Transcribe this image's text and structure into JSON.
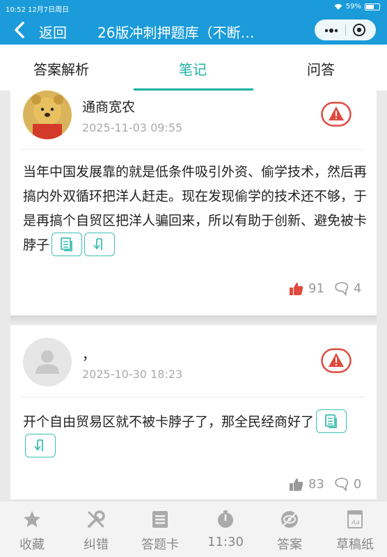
{
  "status_bar": {
    "time_date": "10:52  12月7日周日",
    "battery": "59%"
  },
  "nav": {
    "back_label": "返回",
    "title": "26版冲刺押题库（不断…"
  },
  "tabs": [
    {
      "label": "答案解析"
    },
    {
      "label": "笔记",
      "active": true
    },
    {
      "label": "问答"
    }
  ],
  "notes": [
    {
      "author": "通商宽农",
      "date": "2025-11-03 09:55",
      "content": "当年中国发展靠的就是低条件吸引外资、偷学技术，然后再搞内外双循环把洋人赶走。现在发现偷学的技术还不够，于是再搞个自贸区把洋人骗回来，所以有助于创新、避免被卡脖子",
      "likes": "91",
      "comments": "4",
      "liked": true
    },
    {
      "author": "，",
      "date": "2025-10-30 18:23",
      "content": "开个自由贸易区就不被卡脖子了，那全民经商好了",
      "likes": "83",
      "comments": "0",
      "liked": false
    }
  ],
  "toolbar": [
    {
      "label": "收藏",
      "icon": "star-icon"
    },
    {
      "label": "纠错",
      "icon": "wrench-icon"
    },
    {
      "label": "答题卡",
      "icon": "card-icon"
    },
    {
      "label": "11:30",
      "icon": "timer-icon"
    },
    {
      "label": "答案",
      "icon": "eye-off-icon"
    },
    {
      "label": "草稿纸",
      "icon": "draft-icon"
    }
  ],
  "colors": {
    "nav_bg": "#1b9bd9",
    "accent": "#1ab0a0",
    "report": "#e04a3f",
    "like": "#e04a3f"
  }
}
